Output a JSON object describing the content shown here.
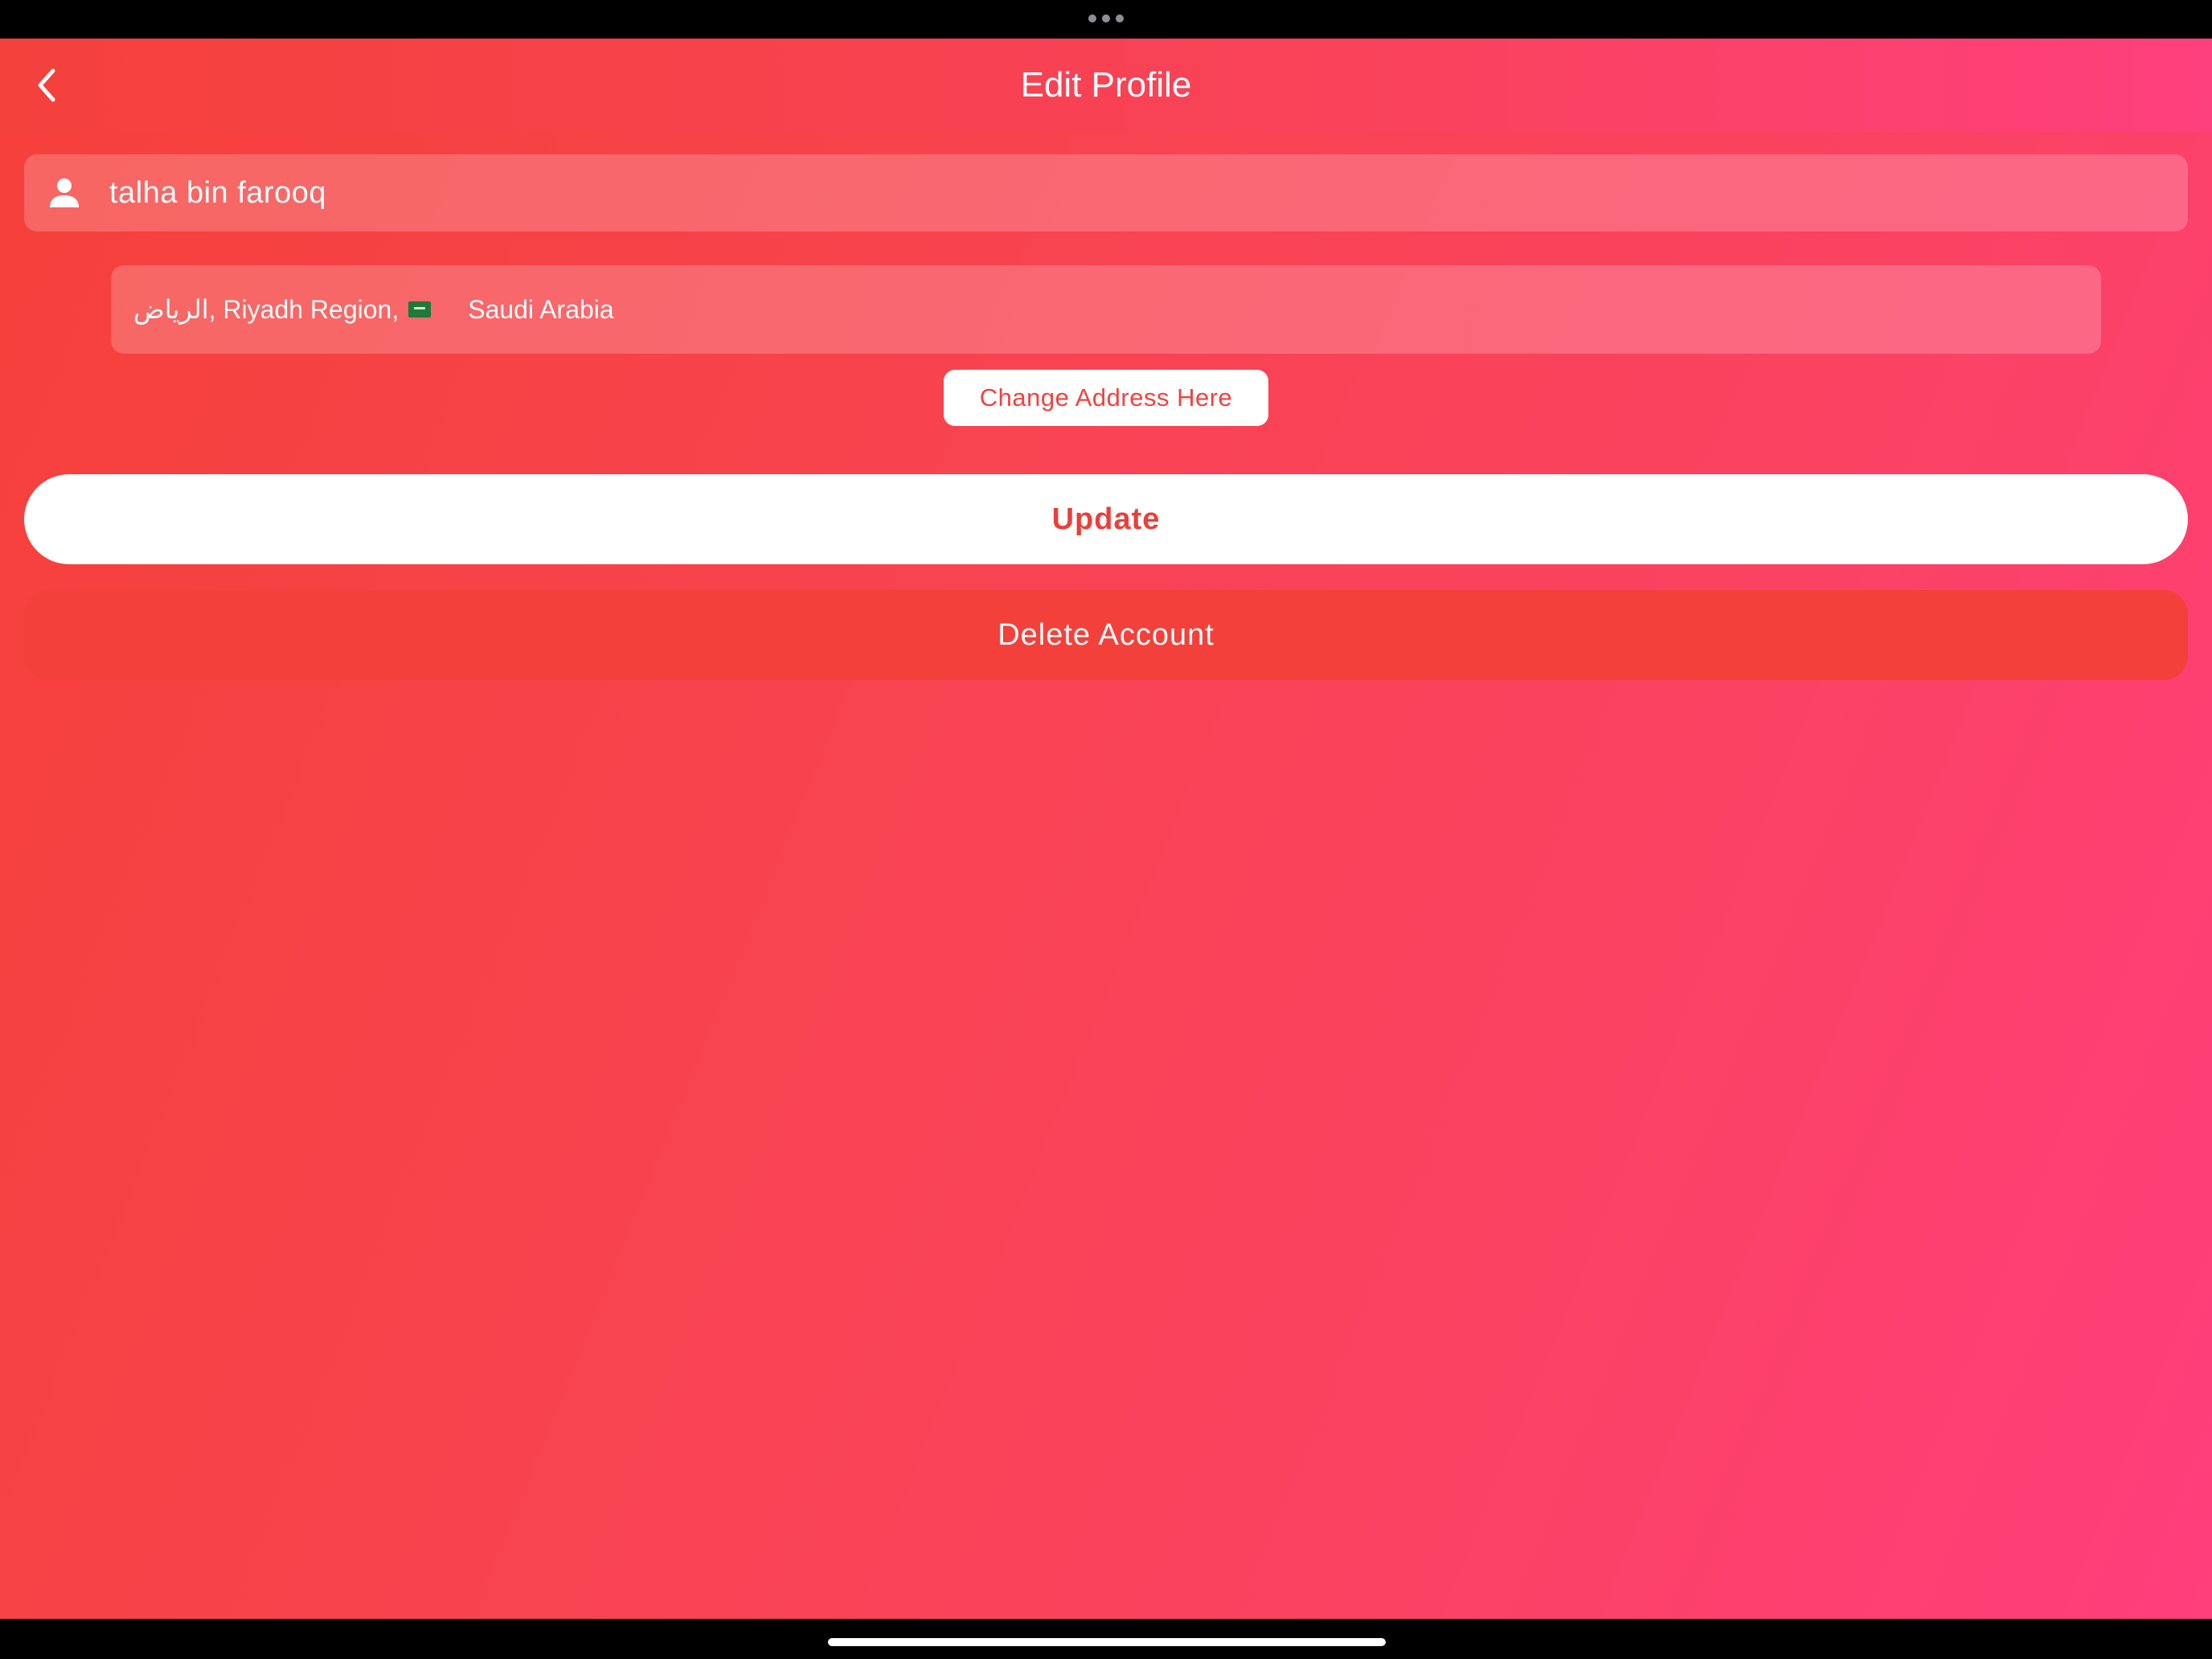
{
  "header": {
    "title": "Edit Profile",
    "back_icon": "chevron-left-icon"
  },
  "profile": {
    "name_icon": "person-icon",
    "name_value": "talha bin farooq",
    "address_prefix": "الرياض, Riyadh Region,",
    "address_flag": "saudi-flag-icon",
    "address_country": "Saudi Arabia"
  },
  "actions": {
    "change_address_label": "Change Address Here",
    "update_label": "Update",
    "delete_label": "Delete Account"
  },
  "colors": {
    "gradient_start": "#f5403a",
    "gradient_end": "#ff3e7c",
    "delete_button": "#f4403a",
    "accent_text": "#e8403b"
  }
}
